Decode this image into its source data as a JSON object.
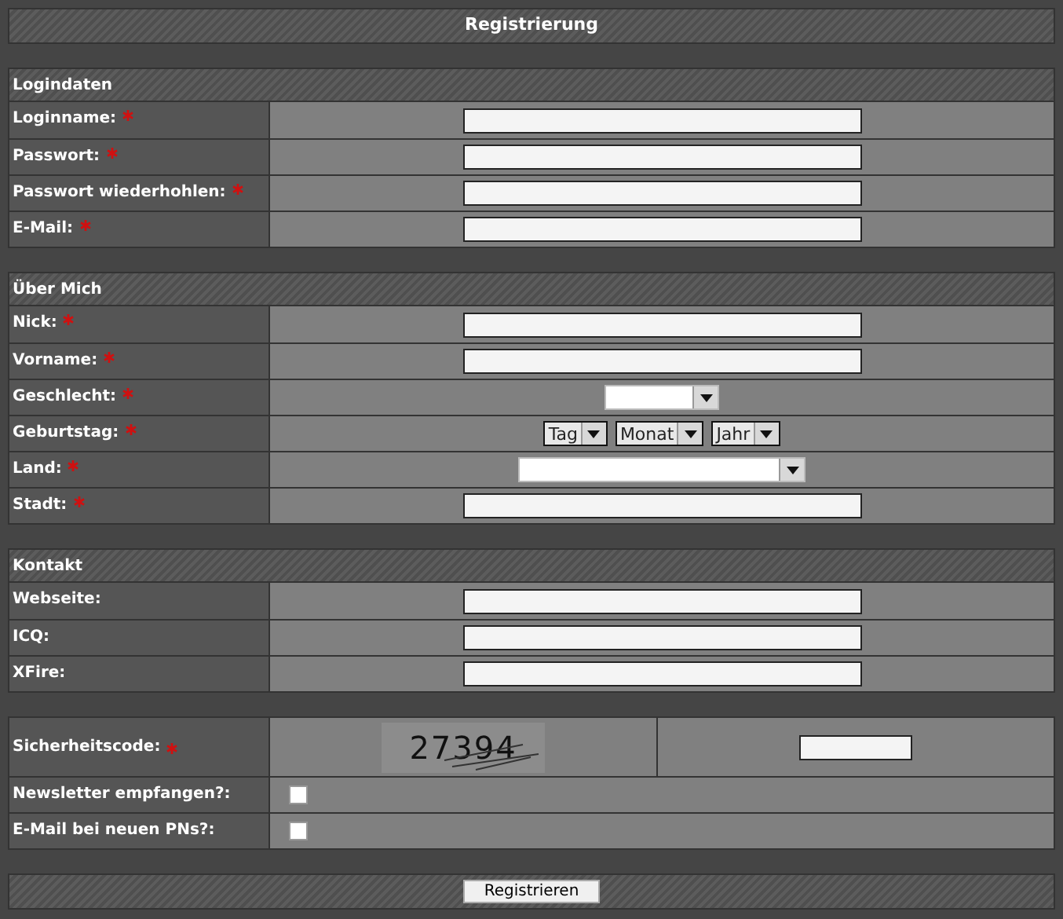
{
  "title": "Registrierung",
  "sections": [
    {
      "heading": "Logindaten",
      "rows": [
        {
          "label": "Loginname:",
          "required": true,
          "kind": "text"
        },
        {
          "label": "Passwort:",
          "required": true,
          "kind": "text"
        },
        {
          "label": "Passwort wiederhohlen:",
          "required": true,
          "kind": "text"
        },
        {
          "label": "E-Mail:",
          "required": true,
          "kind": "text"
        }
      ]
    },
    {
      "heading": "Über Mich",
      "rows": [
        {
          "label": "Nick:",
          "required": true,
          "kind": "text"
        },
        {
          "label": "Vorname:",
          "required": true,
          "kind": "text"
        },
        {
          "label": "Geschlecht:",
          "required": true,
          "kind": "select"
        },
        {
          "label": "Geburtstag:",
          "required": true,
          "kind": "date",
          "selects": [
            "Tag",
            "Monat",
            "Jahr"
          ]
        },
        {
          "label": "Land:",
          "required": true,
          "kind": "wideselect"
        },
        {
          "label": "Stadt:",
          "required": true,
          "kind": "text"
        }
      ]
    },
    {
      "heading": "Kontakt",
      "rows": [
        {
          "label": "Webseite:",
          "required": false,
          "kind": "text"
        },
        {
          "label": "ICQ:",
          "required": false,
          "kind": "text"
        },
        {
          "label": "XFire:",
          "required": false,
          "kind": "text"
        }
      ]
    },
    {
      "rows": [
        {
          "label": "Sicherheitscode:",
          "required": true,
          "kind": "captcha",
          "captcha": "27394"
        },
        {
          "label": "Newsletter empfangen?:",
          "required": false,
          "kind": "checkbox",
          "checked": false
        },
        {
          "label": "E-Mail bei neuen PNs?:",
          "required": false,
          "kind": "checkbox",
          "checked": false
        }
      ]
    }
  ],
  "submit": "Registrieren"
}
